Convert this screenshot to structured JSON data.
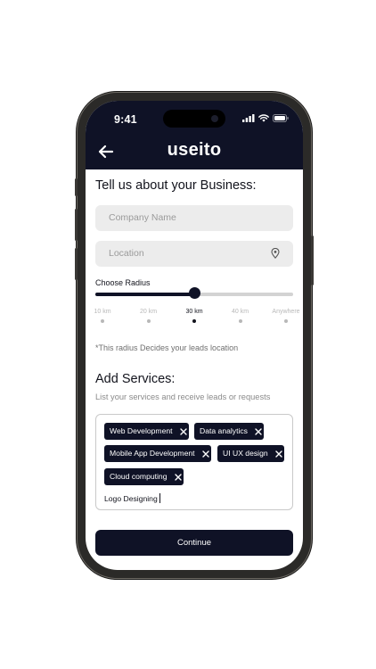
{
  "status_bar": {
    "time": "9:41",
    "icons": [
      "signal-icon",
      "wifi-icon",
      "battery-icon"
    ]
  },
  "header": {
    "brand": "useito",
    "back_icon": "arrow-left-icon"
  },
  "business": {
    "title": "Tell us about your Business:",
    "company_placeholder": "Company Name",
    "location_placeholder": "Location",
    "location_icon": "location-pin-icon"
  },
  "radius": {
    "label": "Choose Radius",
    "selected_index": 2,
    "stops": [
      "10 km",
      "20 km",
      "30 km",
      "40 km",
      "Anywhere"
    ],
    "note": "*This radius Decides your leads location"
  },
  "services": {
    "title": "Add Services:",
    "subtitle": "List your services and receive leads or requests",
    "chips": [
      "Web Development",
      "Data analytics",
      "Mobile App Development",
      "UI UX design",
      "Cloud computing"
    ],
    "input_value": "Logo Designing"
  },
  "continue_label": "Continue",
  "colors": {
    "navy": "#0f1226",
    "field_bg": "#ececec",
    "track": "#d3d3d3"
  }
}
